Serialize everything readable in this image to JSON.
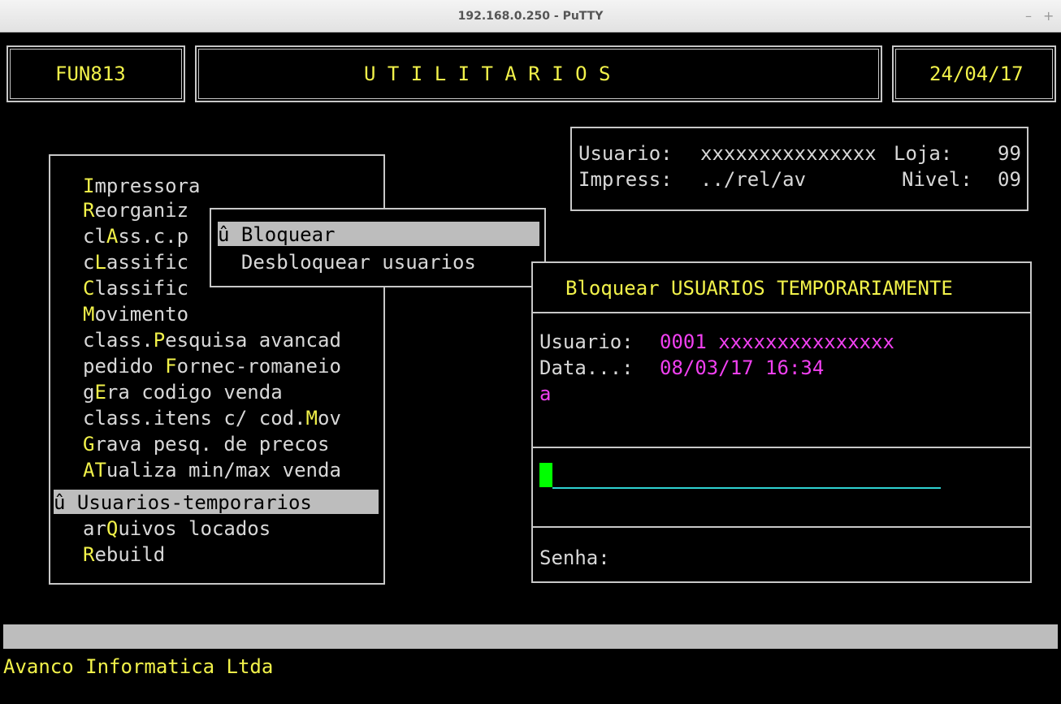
{
  "window": {
    "title": "192.168.0.250 - PuTTY",
    "minimize": "–",
    "maximize": "+"
  },
  "header": {
    "program_code": "FUN813",
    "module_title": "U T I L I T A R I O S",
    "date": "24/04/17"
  },
  "info": {
    "user_label": "Usuario:",
    "user_value": "xxxxxxxxxxxxxxx",
    "store_label": "Loja:",
    "store_value": "99",
    "printer_label": "Impress:",
    "printer_value": "../rel/av",
    "level_label": "Nivel:",
    "level_value": "09"
  },
  "main_menu": {
    "items": [
      {
        "pre": "",
        "hot": "I",
        "post": "mpressora"
      },
      {
        "pre": "",
        "hot": "R",
        "post": "eorganiz"
      },
      {
        "pre": "cl",
        "hot": "A",
        "post": "ss.c.p"
      },
      {
        "pre": "c",
        "hot": "L",
        "post": "assific"
      },
      {
        "pre": "",
        "hot": "C",
        "post": "lassific"
      },
      {
        "pre": "",
        "hot": "M",
        "post": "ovimento"
      },
      {
        "pre": "class.",
        "hot": "P",
        "post": "esquisa avancad"
      },
      {
        "pre": "pedido ",
        "hot": "F",
        "post": "ornec-romaneio"
      },
      {
        "pre": "g",
        "hot": "E",
        "post": "ra codigo venda"
      },
      {
        "pre": "class.itens c/ cod.",
        "hot": "M",
        "post": "ov"
      },
      {
        "pre": "",
        "hot": "G",
        "post": "rava pesq. de precos"
      },
      {
        "pre": "",
        "hot": "AT",
        "post": "ualiza min/max venda"
      },
      {
        "pre": "",
        "hot": "",
        "post": "û Usuarios-temporarios"
      },
      {
        "pre": "ar",
        "hot": "Q",
        "post": "uivos locados"
      },
      {
        "pre": "",
        "hot": "R",
        "post": "ebuild"
      }
    ]
  },
  "submenu": {
    "items": [
      "û Bloquear",
      "  Desbloquear usuarios"
    ]
  },
  "dialog": {
    "title": "Bloquear USUARIOS TEMPORARIAMENTE",
    "user_label": "Usuario:",
    "user_value": "0001 xxxxxxxxxxxxxxx",
    "date_label": "Data...:",
    "date_value": "08/03/17 16:34",
    "note": "a",
    "password_label": "Senha:"
  },
  "footer": {
    "company": "Avanco Informatica Ltda"
  },
  "colors": {
    "text": "#d8d8d8",
    "highlight": "#f2f24a",
    "value": "#f040f0",
    "selection": "#bdbdbd",
    "cursor": "#00ff00",
    "input_line": "#2ed2d2"
  }
}
